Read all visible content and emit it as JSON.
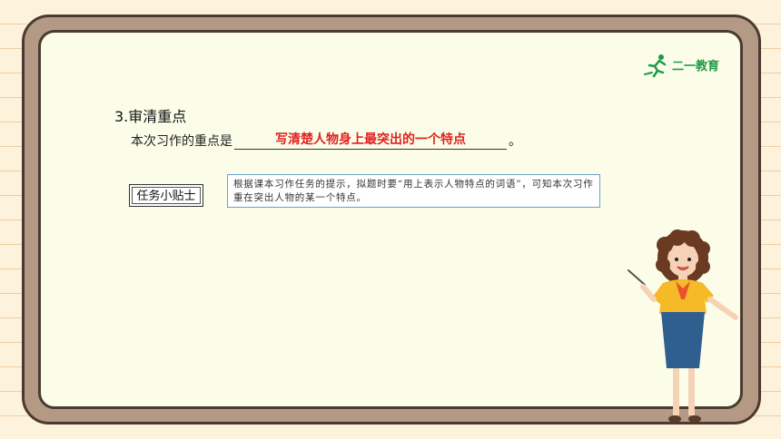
{
  "logo": {
    "text": "二一教育",
    "color": "#1f9a45"
  },
  "section": {
    "heading": "3.审清重点"
  },
  "sentence": {
    "prefix": "本次习作的重点是",
    "answer": "写清楚人物身上最突出的一个特点",
    "suffix": "。"
  },
  "tip": {
    "label": "任务小贴士"
  },
  "hint": {
    "text": "根据课本习作任务的提示，拟题时要“用上表示人物特点的词语”，可知本次习作重在突出人物的某一个特点。"
  },
  "colors": {
    "answer": "#e0221f",
    "board": "#fbfde9",
    "frame": "#b49a84",
    "hint_border": "#6aa0c8"
  }
}
